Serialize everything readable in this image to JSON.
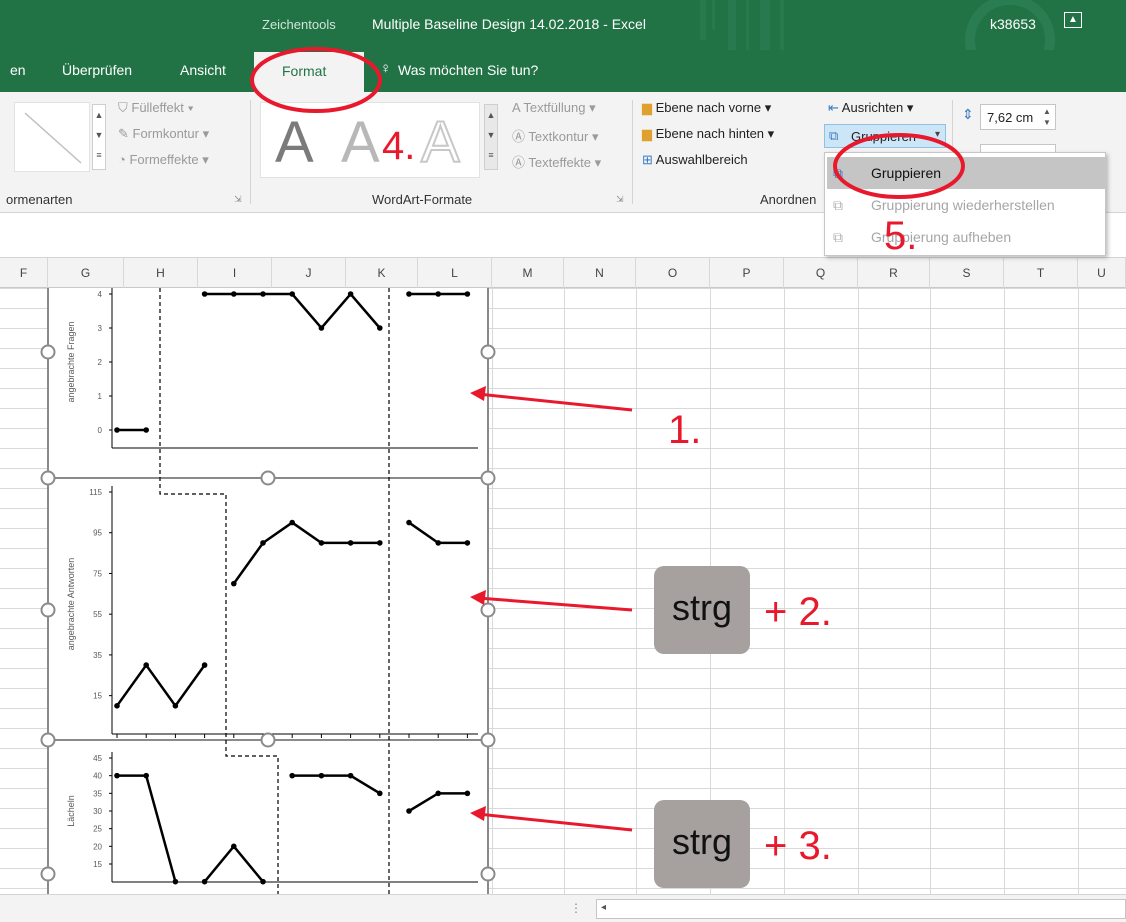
{
  "title_bar": {
    "context_tab": "Zeichentools",
    "document_title": "Multiple Baseline Design 14.02.2018  -  Excel",
    "user": "k38653"
  },
  "tabs": [
    {
      "label": "en"
    },
    {
      "label": "Überprüfen"
    },
    {
      "label": "Ansicht"
    },
    {
      "label": "Format",
      "active": true
    }
  ],
  "tell_me": "Was möchten Sie tun?",
  "ribbon": {
    "shape_styles": {
      "fill": "Fülleffekt",
      "outline": "Formkontur",
      "effects": "Formeffekte",
      "group_label": "ormenarten"
    },
    "wordart": {
      "letter": "A",
      "text_fill": "Textfüllung",
      "text_outline": "Textkontur",
      "text_effects": "Texteffekte",
      "group_label": "WordArt-Formate"
    },
    "arrange": {
      "bring_forward": "Ebene nach vorne",
      "send_backward": "Ebene nach hinten",
      "selection_pane": "Auswahlbereich",
      "align": "Ausrichten",
      "group": "Gruppieren",
      "group_label": "Anordnen"
    },
    "size": {
      "height": "7,62 cm"
    }
  },
  "group_menu": {
    "items": [
      {
        "label": "Gruppieren",
        "enabled": true
      },
      {
        "label": "Gruppierung wiederherstellen",
        "enabled": false
      },
      {
        "label": "Gruppierung aufheben",
        "enabled": false
      }
    ]
  },
  "columns": [
    "F",
    "G",
    "H",
    "I",
    "J",
    "K",
    "L",
    "M",
    "N",
    "O",
    "P",
    "Q",
    "R",
    "S",
    "T",
    "U"
  ],
  "annotations": {
    "step1": "1.",
    "step2": "+ 2.",
    "step3": "+ 3.",
    "step4": "4.",
    "step5": "5.",
    "key": "strg"
  },
  "colors": {
    "accent": "#217346",
    "annotation_red": "#e8192c"
  },
  "chart_data": [
    {
      "type": "line",
      "ylabel": "angebrachte Fragen",
      "ylim": [
        0,
        4
      ],
      "yticks": [
        0,
        1,
        2,
        3,
        4
      ],
      "x": [
        1,
        2,
        3,
        4,
        5,
        6,
        7,
        8,
        9,
        10,
        11,
        12,
        13
      ],
      "segments": [
        {
          "x": [
            1,
            2
          ],
          "values": [
            0,
            0
          ]
        },
        {
          "x": [
            4,
            5,
            6,
            7,
            8,
            9,
            10
          ],
          "values": [
            4,
            4,
            4,
            4,
            3,
            4,
            3
          ]
        },
        {
          "x": [
            11,
            12,
            13
          ],
          "values": [
            4,
            4,
            4
          ]
        }
      ]
    },
    {
      "type": "line",
      "ylabel": "angebrachte Antworten",
      "ylim": [
        5,
        115
      ],
      "yticks": [
        15,
        35,
        55,
        75,
        95,
        115
      ],
      "x": [
        1,
        2,
        3,
        4,
        5,
        6,
        7,
        8,
        9,
        10,
        11,
        12,
        13
      ],
      "segments": [
        {
          "x": [
            1,
            2,
            3,
            4
          ],
          "values": [
            10,
            30,
            10,
            30
          ]
        },
        {
          "x": [
            5,
            6,
            7,
            8,
            9,
            10
          ],
          "values": [
            70,
            90,
            100,
            90,
            90,
            90
          ]
        },
        {
          "x": [
            11,
            12,
            13
          ],
          "values": [
            100,
            90,
            90
          ]
        }
      ]
    },
    {
      "type": "line",
      "ylabel": "Lächeln",
      "ylim": [
        15,
        45
      ],
      "yticks": [
        15,
        20,
        25,
        30,
        35,
        40,
        45
      ],
      "x": [
        1,
        2,
        3,
        4,
        5,
        6,
        7,
        8,
        9,
        10,
        11,
        12,
        13
      ],
      "segments": [
        {
          "x": [
            1,
            2,
            3
          ],
          "values": [
            40,
            40,
            10
          ]
        },
        {
          "x": [
            4,
            5,
            6
          ],
          "values": [
            10,
            20,
            10
          ]
        },
        {
          "x": [
            7,
            8,
            9,
            10
          ],
          "values": [
            40,
            40,
            40,
            35
          ]
        },
        {
          "x": [
            11,
            12,
            13
          ],
          "values": [
            30,
            35,
            35
          ]
        }
      ]
    }
  ]
}
